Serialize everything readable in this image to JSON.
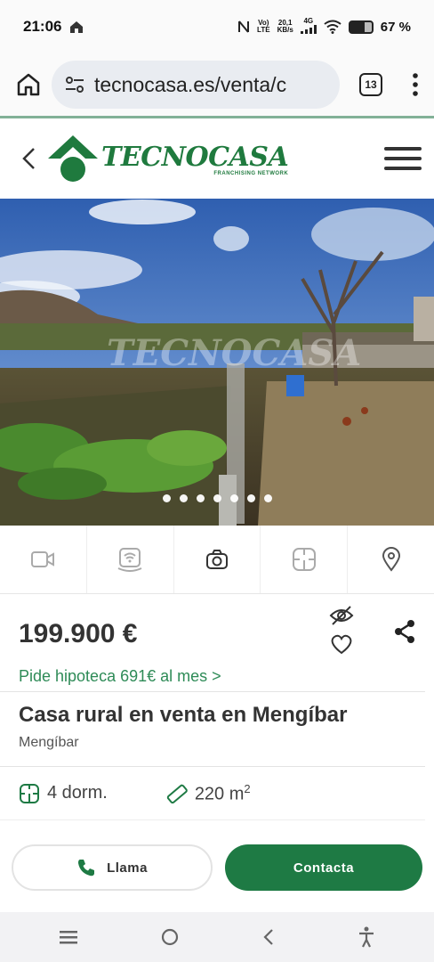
{
  "status": {
    "time": "21:06",
    "net_top": "Vo)",
    "net_bottom": "LTE",
    "speed_top": "20,1",
    "speed_bottom": "KB/s",
    "signal_label": "4G",
    "battery": "67 %",
    "battery_level": 0.67
  },
  "browser": {
    "url": "tecnocasa.es/venta/c",
    "tab_count": "13"
  },
  "header": {
    "brand": "TECNOCASA",
    "tagline": "FRANCHISING NETWORK"
  },
  "gallery": {
    "watermark": "TECNOCASA",
    "dot_count": 7,
    "active_dot": 0
  },
  "media_tabs": [
    {
      "icon": "video-icon"
    },
    {
      "icon": "virtual-tour-icon"
    },
    {
      "icon": "camera-icon"
    },
    {
      "icon": "floorplan-icon"
    },
    {
      "icon": "location-pin-icon"
    }
  ],
  "listing": {
    "price": "199.900 €",
    "mortgage": "Pide hipoteca 691€ al mes >",
    "title": "Casa rural en venta en Mengíbar",
    "location": "Mengíbar",
    "bedrooms": "4 dorm.",
    "area": "220 m",
    "area_unit_sup": "2"
  },
  "actions": {
    "call_label": "Llama",
    "contact_label": "Contacta"
  },
  "colors": {
    "brand_green": "#1e7a44",
    "mortgage_green": "#2e8b57"
  }
}
